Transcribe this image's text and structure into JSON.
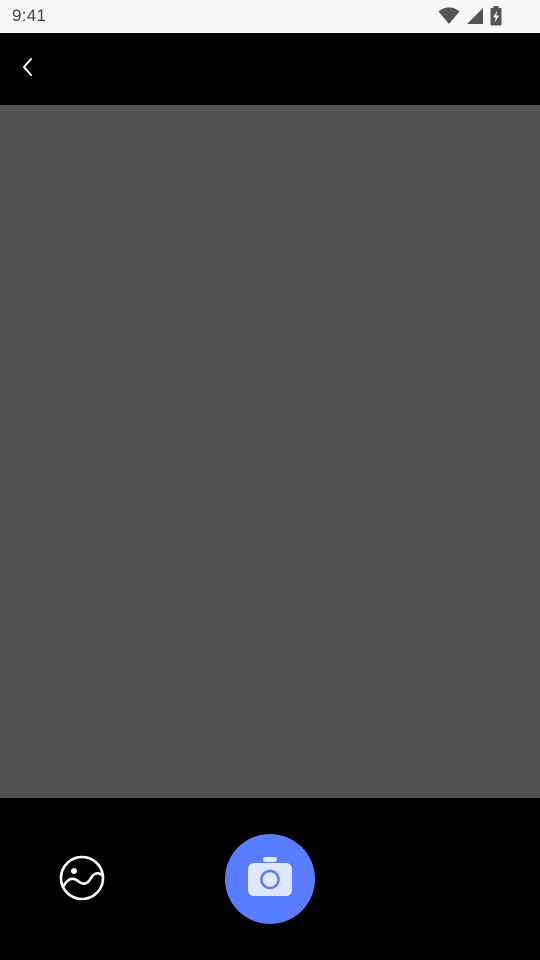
{
  "status_bar": {
    "time": "9:41",
    "icons": [
      "wifi-icon",
      "cell-signal-icon",
      "battery-charging-icon"
    ]
  },
  "top_bar": {
    "back_icon": "chevron-left-icon"
  },
  "bottom_bar": {
    "gallery_icon": "gallery-icon",
    "shutter_icon": "camera-icon"
  },
  "colors": {
    "status_bar_bg": "#f7f7f7",
    "status_text": "#444444",
    "chrome_bg": "#000000",
    "viewfinder_bg": "#525252",
    "shutter_bg": "#5a7cff",
    "camera_icon_fill": "#dfe6ff",
    "camera_icon_accent": "#5a7cff",
    "icon_white": "#ffffff"
  }
}
